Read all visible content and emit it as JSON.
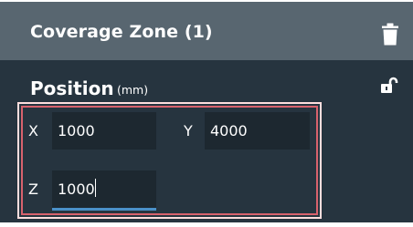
{
  "header": {
    "title": "Coverage Zone (1)",
    "delete_icon": "trash-icon"
  },
  "position": {
    "title": "Position",
    "unit": "(mm)",
    "lock_icon": "unlocked-padlock-icon",
    "x_label": "X",
    "x_value": "1000",
    "y_label": "Y",
    "y_value": "4000",
    "z_label": "Z",
    "z_value": "1000"
  },
  "colors": {
    "header_bg": "#586670",
    "panel_bg": "#26343f",
    "field_bg": "#1d2830",
    "highlight": "#d8626d",
    "focus_underline": "#4a90c8"
  }
}
